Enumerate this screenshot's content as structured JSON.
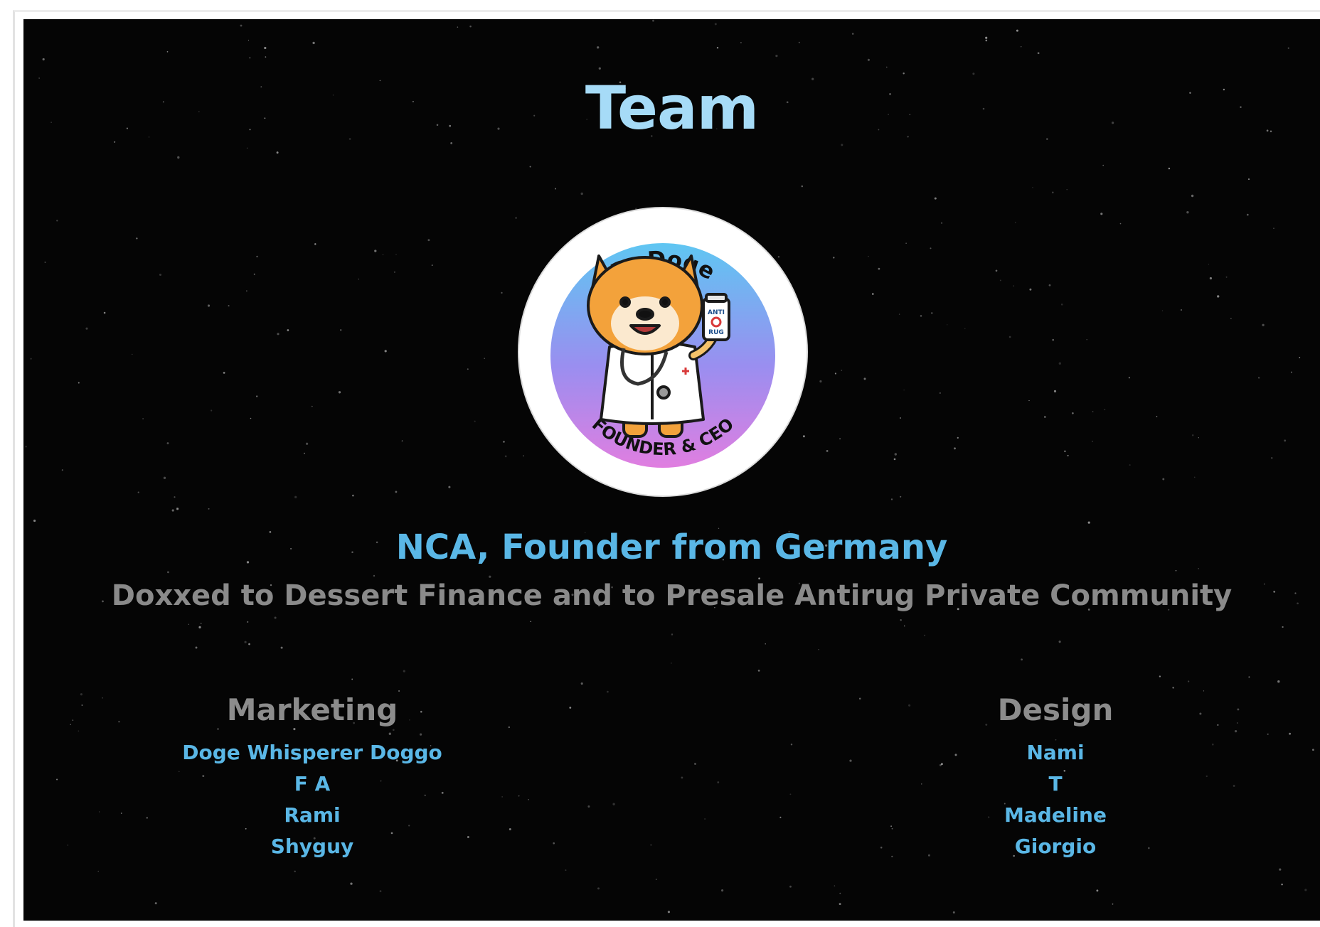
{
  "title": "Team",
  "founder": {
    "badge": {
      "top_text": "Dr.Doge",
      "bottom_text": "FOUNDER & CEO",
      "bottle_text": [
        "ANTI",
        "RUG"
      ],
      "gradient": [
        "#5fc6f2",
        "#9a8ef0",
        "#e07ee0"
      ]
    },
    "name": "NCA, Founder from Germany",
    "description": "Doxxed to Dessert Finance and to Presale Antirug Private Community"
  },
  "teams": {
    "marketing": {
      "heading": "Marketing",
      "members": [
        "Doge Whisperer Doggo",
        "F A",
        "Rami",
        "Shyguy"
      ]
    },
    "design": {
      "heading": "Design",
      "members": [
        "Nami",
        "T",
        "Madeline",
        "Giorgio"
      ]
    }
  },
  "colors": {
    "background": "#050505",
    "title": "#a6dbf7",
    "accent": "#5ab7e6",
    "muted": "#8a8a8a"
  }
}
